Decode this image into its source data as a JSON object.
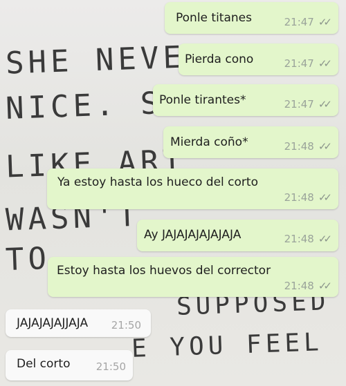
{
  "wallpaper": {
    "lines": [
      "SHE NEVE",
      "NICE. S",
      "LIKE ART",
      "WASN'T",
      "TO",
      "",
      "SUPPOSED",
      "",
      "E YOU FEEL"
    ]
  },
  "messages": [
    {
      "text": "Ponle titanes",
      "time": "21:47",
      "dir": "out",
      "ticks": "✓✓"
    },
    {
      "text": "Pierda cono",
      "time": "21:47",
      "dir": "out",
      "ticks": "✓✓"
    },
    {
      "text": "Ponle tirantes*",
      "time": "21:47",
      "dir": "out",
      "ticks": "✓✓"
    },
    {
      "text": "Mierda coño*",
      "time": "21:48",
      "dir": "out",
      "ticks": "✓✓"
    },
    {
      "text": "Ya estoy hasta los hueco del corto",
      "time": "21:48",
      "dir": "out",
      "ticks": "✓✓"
    },
    {
      "text": "Ay JAJAJAJAJAJAJA",
      "time": "21:48",
      "dir": "out",
      "ticks": "✓✓"
    },
    {
      "text": "Estoy hasta los huevos del corrector",
      "time": "21:48",
      "dir": "out",
      "ticks": "✓✓"
    },
    {
      "text": "JAJAJAJAJJAJA",
      "time": "21:50",
      "dir": "in"
    },
    {
      "text": "Del corto",
      "time": "21:50",
      "dir": "in"
    }
  ]
}
